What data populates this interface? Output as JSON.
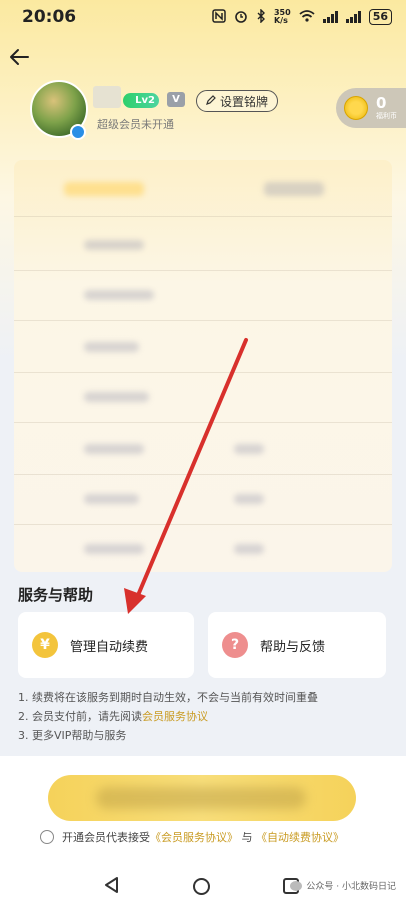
{
  "status_bar": {
    "time": "20:06",
    "network_speed_value": "350",
    "network_speed_unit": "K/s",
    "battery": "56"
  },
  "header": {
    "member_status": "超级会员未开通",
    "level_badge": "Lv2",
    "v_badge": "V",
    "set_badge_button": "设置铭牌",
    "coins": {
      "count": "0",
      "label": "福利币"
    }
  },
  "services": {
    "title": "服务与帮助",
    "cards": [
      {
        "label": "管理自动续费",
        "icon": "yen-icon",
        "icon_glyph": "¥"
      },
      {
        "label": "帮助与反馈",
        "icon": "help-icon",
        "icon_glyph": "?"
      }
    ],
    "notes": {
      "line1": "1. 续费将在该服务到期时自动生效，不会与当前有效时间重叠",
      "line2_prefix": "2. 会员支付前，请先阅读",
      "line2_link": "会员服务协议",
      "line3": "3. 更多VIP帮助与服务"
    }
  },
  "bottom": {
    "agreement_prefix": "开通会员代表接受",
    "agreement_link1": "《会员服务协议》",
    "agreement_and": "与",
    "agreement_link2": "《自动续费协议》"
  },
  "watermark": "公众号 · 小北数码日记",
  "colors": {
    "accent_gold": "#c99b22",
    "button_yellow": "#f5d25a",
    "annotation_red": "#d8302c"
  }
}
